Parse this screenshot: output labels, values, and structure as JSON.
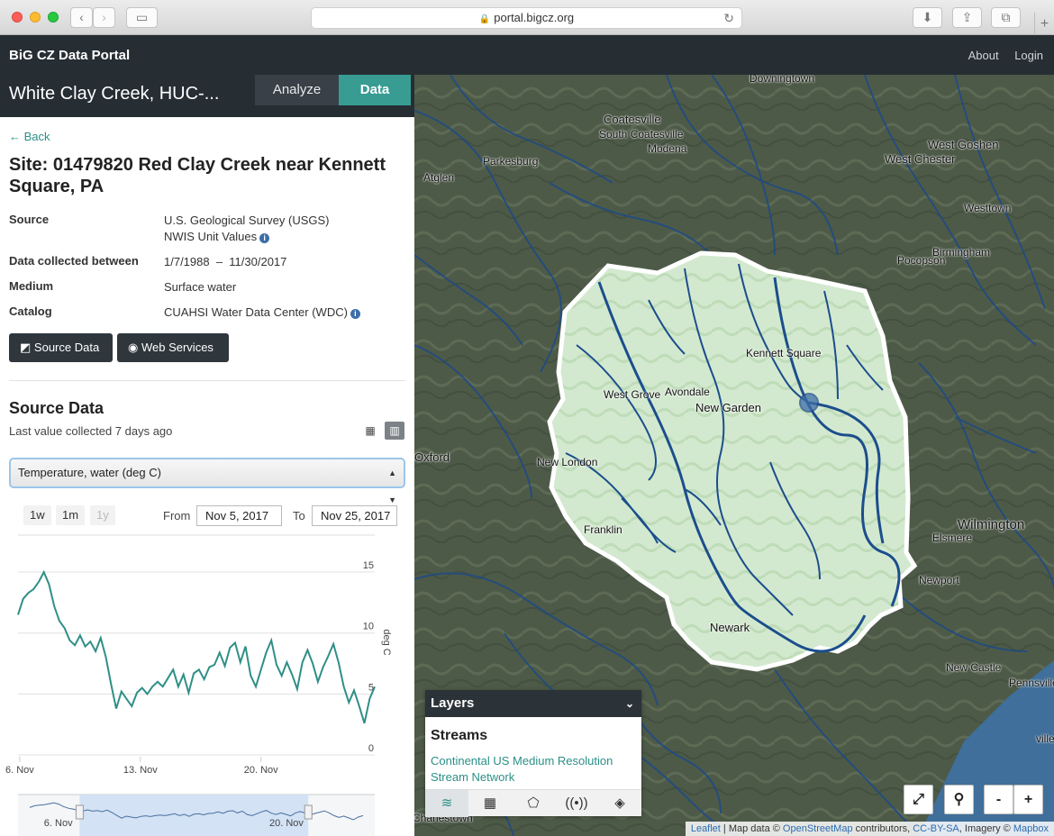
{
  "browser": {
    "url": "portal.bigcz.org",
    "lock": "🔒"
  },
  "app": {
    "brand": "BiG CZ Data Portal",
    "nav": [
      "About",
      "Login"
    ]
  },
  "sidebar": {
    "title": "White Clay Creek, HUC-...",
    "tabs": [
      "Analyze",
      "Data"
    ],
    "back": "← Back",
    "site_title": "Site: 01479820 Red Clay Creek near Kennett Square, PA",
    "meta": {
      "source_label": "Source",
      "source_value_1": "U.S. Geological Survey (USGS)",
      "source_value_2": "NWIS Unit Values",
      "collected_label": "Data collected between",
      "collected_value": "1/7/1988  –  11/30/2017",
      "medium_label": "Medium",
      "medium_value": "Surface water",
      "catalog_label": "Catalog",
      "catalog_value": "CUAHSI Water Data Center (WDC)"
    },
    "buttons": {
      "source_data": "Source Data",
      "web_services": "Web Services"
    },
    "source_heading": "Source Data",
    "last_value": "Last value collected 7 days ago",
    "variable": "Temperature, water (deg C)",
    "ranges": [
      "1w",
      "1m",
      "1y"
    ],
    "from_label": "From",
    "from_value": "Nov 5, 2017",
    "to_label": "To",
    "to_value": "Nov 25, 2017"
  },
  "chart_data": {
    "type": "line",
    "title": "",
    "xlabel": "",
    "ylabel": "deg C",
    "ylim": [
      0,
      17
    ],
    "y_ticks": [
      0,
      5,
      10,
      15
    ],
    "x_tick_labels": [
      "6. Nov",
      "13. Nov",
      "20. Nov"
    ],
    "x_tick_days": [
      6,
      13,
      20
    ],
    "xlim": [
      5.9,
      26.6
    ],
    "series": [
      {
        "x": [
          5.9,
          6.2,
          6.5,
          6.8,
          7.1,
          7.4,
          7.7,
          8.0,
          8.3,
          8.6,
          8.9,
          9.2,
          9.5,
          9.8,
          10.1,
          10.4,
          10.7,
          11.0,
          11.3,
          11.6,
          11.9,
          12.2,
          12.5,
          12.8,
          13.1,
          13.4,
          13.7,
          14.0,
          14.3,
          14.6,
          14.9,
          15.2,
          15.5,
          15.8,
          16.1,
          16.4,
          16.7,
          17.0,
          17.3,
          17.6,
          17.9,
          18.2,
          18.5,
          18.8,
          19.1,
          19.4,
          19.7,
          20.0,
          20.3,
          20.6,
          20.9,
          21.2,
          21.5,
          21.8,
          22.1,
          22.4,
          22.7,
          23.0,
          23.3,
          23.6,
          23.9,
          24.2,
          24.5,
          24.8,
          25.1,
          25.4,
          25.7,
          26.0,
          26.3,
          26.6
        ],
        "y": [
          11.5,
          12.8,
          13.3,
          13.6,
          14.2,
          15.0,
          14.0,
          12.2,
          11.0,
          10.4,
          9.4,
          9.0,
          9.8,
          8.9,
          9.3,
          8.5,
          9.6,
          8.0,
          5.8,
          3.8,
          5.2,
          4.6,
          4.0,
          5.1,
          5.5,
          5.0,
          5.6,
          6.0,
          5.6,
          6.3,
          7.0,
          5.6,
          6.6,
          5.1,
          6.7,
          7.0,
          6.2,
          7.2,
          7.4,
          8.4,
          7.3,
          8.8,
          9.2,
          7.6,
          8.9,
          6.5,
          5.6,
          7.0,
          8.4,
          9.4,
          7.4,
          6.5,
          7.6,
          6.6,
          5.4,
          7.6,
          8.6,
          7.5,
          6.0,
          7.2,
          8.1,
          9.1,
          7.6,
          5.6,
          4.3,
          5.3,
          4.0,
          2.6,
          4.6,
          5.6
        ]
      }
    ],
    "navigator": {
      "x_tick_labels": [
        "6. Nov",
        "20. Nov"
      ]
    }
  },
  "map": {
    "places": [
      "Downingtown",
      "Coatesville",
      "South Coatesville",
      "Modena",
      "Parkesburg",
      "Atglen",
      "West Goshen",
      "West Chester",
      "Westtown",
      "Birmingham",
      "Pocopson",
      "Kennett Square",
      "West Grove",
      "Avondale",
      "New Garden",
      "Oxford",
      "New London",
      "Franklin",
      "Wilmington",
      "Elsmere",
      "Newport",
      "Newark",
      "New Castle",
      "Pennsville",
      "Charlestown",
      "ville"
    ],
    "layers_title": "Layers",
    "layers_sub": "Streams",
    "layers_link": "Continental US Medium Resolution Stream Network",
    "controls": [
      "⤢",
      "⚲",
      "-",
      "+"
    ],
    "attribution": {
      "leaflet": "Leaflet",
      "sep1": " | Map data © ",
      "osm": "OpenStreetMap",
      "sep2": " contributors, ",
      "license": "CC-BY-SA",
      "sep3": ", Imagery © ",
      "mapbox": "Mapbox"
    }
  },
  "colors": {
    "teal": "#389c93",
    "dark": "#262d33",
    "river": "#1b4e8c",
    "watershed": "#d7ecd1"
  }
}
